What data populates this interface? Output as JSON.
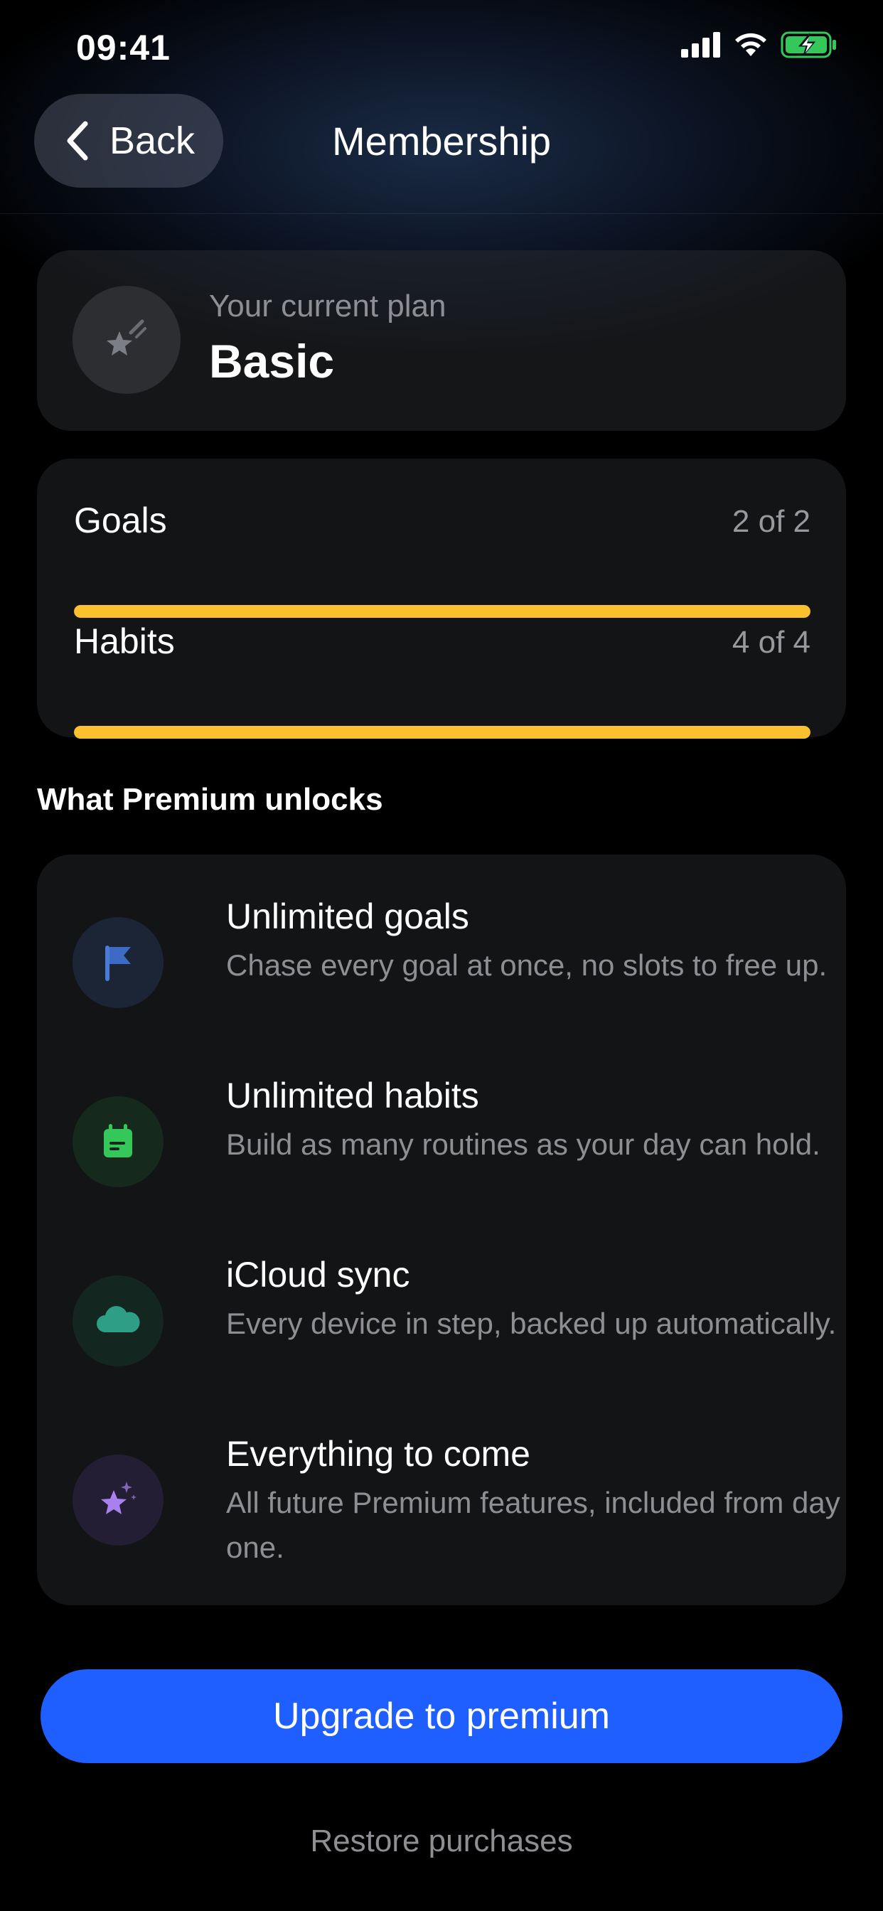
{
  "status_bar": {
    "time": "09:41",
    "icons": [
      "cellular-signal-icon",
      "wifi-icon",
      "battery-charging-icon"
    ]
  },
  "nav": {
    "back_label": "Back",
    "title": "Membership"
  },
  "current_plan": {
    "subtitle": "Your current plan",
    "name": "Basic",
    "icon": "star-sparkle-icon"
  },
  "usage": [
    {
      "label": "Goals",
      "count": "2 of 2",
      "fill_fraction": 1.0
    },
    {
      "label": "Habits",
      "count": "4 of 4",
      "fill_fraction": 1.0
    }
  ],
  "premium": {
    "section_title": "What Premium unlocks",
    "features": [
      {
        "title": "Unlimited goals",
        "description": "Chase every goal at once, no slots to free up.",
        "icon": "flag-icon",
        "icon_color": "#4a7bd6"
      },
      {
        "title": "Unlimited habits",
        "description": "Build as many routines as your day can hold.",
        "icon": "calendar-icon",
        "icon_color": "#34c759"
      },
      {
        "title": "iCloud sync",
        "description": "Every device in step, backed up automatically.",
        "icon": "cloud-icon",
        "icon_color": "#2f9e86"
      },
      {
        "title": "Everything to come",
        "description": "All future Premium features, included from day one.",
        "icon": "sparkle-star-icon",
        "icon_color": "#a781f0"
      }
    ]
  },
  "actions": {
    "upgrade_label": "Upgrade to premium",
    "restore_label": "Restore purchases"
  },
  "colors": {
    "accent_blue": "#1f5eff",
    "progress_yellow": "#fbc02d",
    "background": "#000000",
    "card": "#131415"
  }
}
